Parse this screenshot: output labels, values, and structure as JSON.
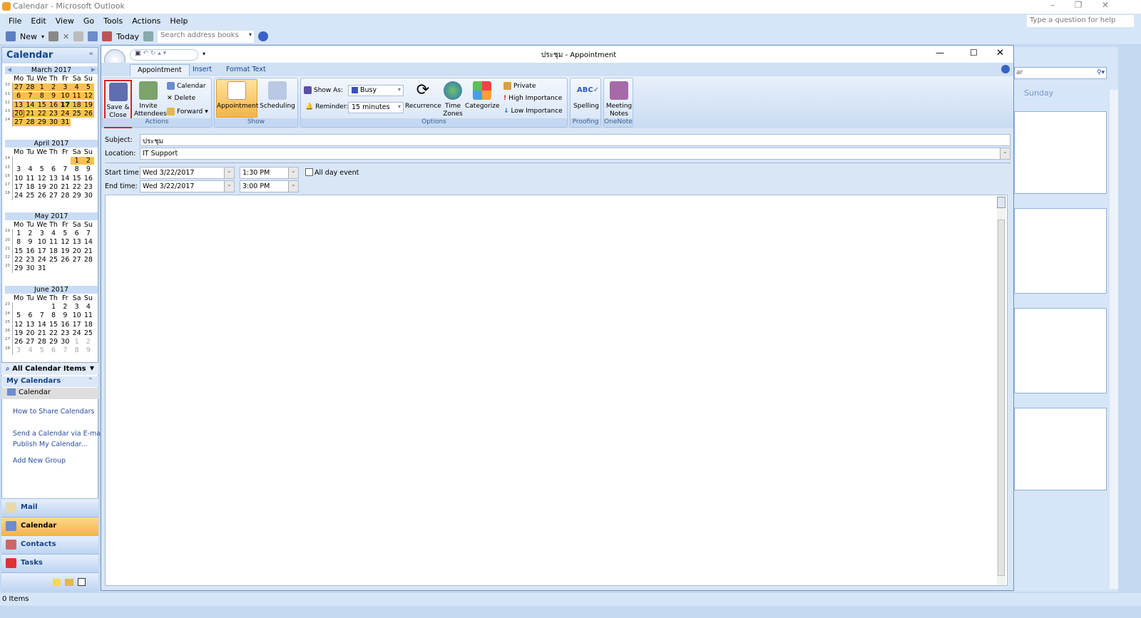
{
  "window": {
    "title": "Calendar - Microsoft Outlook",
    "help_placeholder": "Type a question for help"
  },
  "menu": [
    "File",
    "Edit",
    "View",
    "Go",
    "Tools",
    "Actions",
    "Help"
  ],
  "toolbar": {
    "new": "New",
    "today": "Today",
    "search_placeholder": "Search address books"
  },
  "nav": {
    "title": "Calendar",
    "months": [
      {
        "title": "March 2017",
        "weeks": [
          [
            "10",
            "27",
            "28",
            "1",
            "2",
            "3",
            "4",
            "5"
          ],
          [
            "11",
            "6",
            "7",
            "8",
            "9",
            "10",
            "11",
            "12"
          ],
          [
            "12",
            "13",
            "14",
            "15",
            "16",
            "17",
            "18",
            "19"
          ],
          [
            "13",
            "20",
            "21",
            "22",
            "23",
            "24",
            "25",
            "26"
          ],
          [
            "14",
            "27",
            "28",
            "29",
            "30",
            "31",
            "",
            ""
          ]
        ],
        "highlight": "all",
        "selected": "20",
        "bold": "17"
      },
      {
        "title": "April 2017",
        "weeks": [
          [
            "14",
            "",
            "",
            "",
            "",
            "",
            "1",
            "2"
          ],
          [
            "15",
            "3",
            "4",
            "5",
            "6",
            "7",
            "8",
            "9"
          ],
          [
            "16",
            "10",
            "11",
            "12",
            "13",
            "14",
            "15",
            "16"
          ],
          [
            "17",
            "17",
            "18",
            "19",
            "20",
            "21",
            "22",
            "23"
          ],
          [
            "18",
            "24",
            "25",
            "26",
            "27",
            "28",
            "29",
            "30"
          ]
        ],
        "highlight": [
          "1",
          "2"
        ]
      },
      {
        "title": "May 2017",
        "weeks": [
          [
            "19",
            "1",
            "2",
            "3",
            "4",
            "5",
            "6",
            "7"
          ],
          [
            "20",
            "8",
            "9",
            "10",
            "11",
            "12",
            "13",
            "14"
          ],
          [
            "21",
            "15",
            "16",
            "17",
            "18",
            "19",
            "20",
            "21"
          ],
          [
            "22",
            "22",
            "23",
            "24",
            "25",
            "26",
            "27",
            "28"
          ],
          [
            "23",
            "29",
            "30",
            "31",
            "",
            "",
            "",
            ""
          ]
        ]
      },
      {
        "title": "June 2017",
        "weeks": [
          [
            "23",
            "",
            "",
            "",
            "1",
            "2",
            "3",
            "4"
          ],
          [
            "24",
            "5",
            "6",
            "7",
            "8",
            "9",
            "10",
            "11"
          ],
          [
            "25",
            "12",
            "13",
            "14",
            "15",
            "16",
            "17",
            "18"
          ],
          [
            "26",
            "19",
            "20",
            "21",
            "22",
            "23",
            "24",
            "25"
          ],
          [
            "27",
            "26",
            "27",
            "28",
            "29",
            "30",
            "1",
            "2"
          ],
          [
            "28",
            "3",
            "4",
            "5",
            "6",
            "7",
            "8",
            "9"
          ]
        ],
        "dim_after": "30"
      }
    ],
    "dow": [
      "Mo",
      "Tu",
      "We",
      "Th",
      "Fr",
      "Sa",
      "Su"
    ],
    "view_selector": "All Calendar Items",
    "my_calendars": "My Calendars",
    "calendar_item": "Calendar",
    "links": [
      "How to Share Calendars",
      "Send a Calendar via E-mail...",
      "Publish My Calendar...",
      "Add New Group"
    ],
    "buttons": [
      "Mail",
      "Calendar",
      "Contacts",
      "Tasks"
    ],
    "active_button": "Calendar"
  },
  "status": "0 Items",
  "right_pane": {
    "day": "Sunday",
    "search_partial": "ar"
  },
  "appointment": {
    "title": "ประชุม - Appointment",
    "tabs": [
      "Appointment",
      "Insert",
      "Format Text"
    ],
    "ribbon": {
      "save_close": "Save & Close",
      "invite": "Invite Attendees",
      "calendar": "Calendar",
      "delete": "Delete",
      "forward": "Forward",
      "actions": "Actions",
      "appointment": "Appointment",
      "scheduling": "Scheduling",
      "show": "Show",
      "show_as_label": "Show As:",
      "show_as": "Busy",
      "reminder_label": "Reminder:",
      "reminder": "15 minutes",
      "recurrence": "Recurrence",
      "time_zones": "Time Zones",
      "categorize": "Categorize",
      "private": "Private",
      "high": "High Importance",
      "low": "Low Importance",
      "options": "Options",
      "spelling": "Spelling",
      "proofing": "Proofing",
      "meeting_notes": "Meeting Notes",
      "onenote": "OneNote"
    },
    "form": {
      "subject_label": "Subject:",
      "subject": "ประชุม",
      "location_label": "Location:",
      "location": "IT Support",
      "start_label": "Start time:",
      "start_date": "Wed 3/22/2017",
      "start_time": "1:30 PM",
      "allday": "All day event",
      "end_label": "End time:",
      "end_date": "Wed 3/22/2017",
      "end_time": "3:00 PM"
    }
  },
  "colors": {
    "accent": "#f7c24e",
    "selected_box": "#d22222",
    "link": "#2a4ea0",
    "frame": "#c5d9f1"
  }
}
